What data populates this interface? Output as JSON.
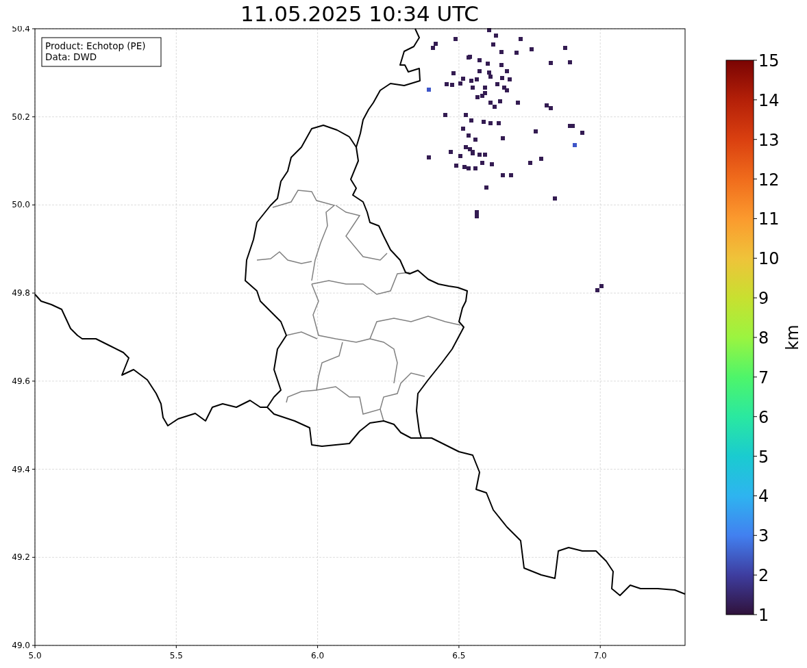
{
  "title": "11.05.2025 10:34 UTC",
  "info_box": [
    "Product: Echotop (PE)",
    "Data: DWD"
  ],
  "map_plot": {
    "xticks": [
      "5.0",
      "5.5",
      "6.0",
      "6.5",
      "7.0"
    ],
    "yticks": [
      "50.4",
      "50.2",
      "50.0",
      "49.8",
      "49.6",
      "49.4",
      "49.2",
      "49.0"
    ]
  },
  "colorbar": {
    "label": "km",
    "ticks": [
      "15",
      "14",
      "13",
      "12",
      "11",
      "10",
      "9",
      "8",
      "7",
      "6",
      "5",
      "4",
      "3",
      "2",
      "1"
    ]
  }
}
